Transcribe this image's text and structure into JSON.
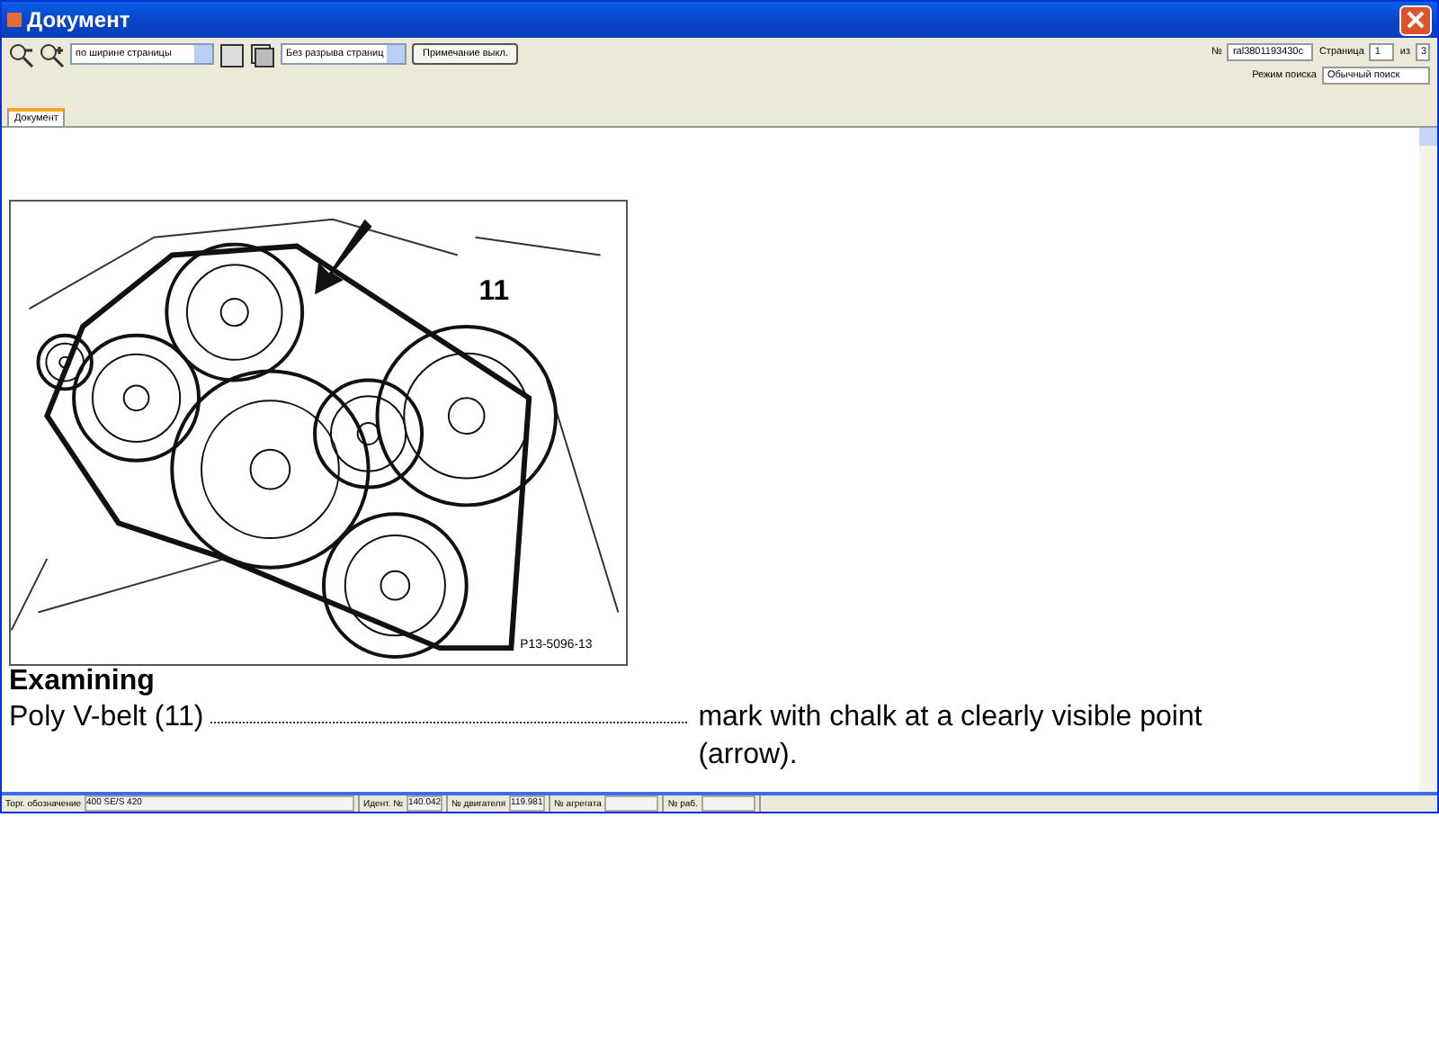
{
  "window": {
    "title": "Документ"
  },
  "toolbar": {
    "zoom_select": "по ширине страницы",
    "page_mode_select": "Без разрыва страниц",
    "notes_button": "Примечание выкл.",
    "number_label": "№",
    "number_value": "ral3801193430c",
    "page_label": "Страница",
    "page_value": "1",
    "of_label": "из",
    "page_total": "3",
    "search_mode_label": "Режим поиска",
    "search_mode_value": "Обычный поиск"
  },
  "tabs": [
    {
      "label": "Документ",
      "selected": true
    }
  ],
  "document": {
    "figure": {
      "callout": "11",
      "code": "P13-5096-13"
    },
    "heading": "Examining",
    "steps": [
      {
        "item": "Poly V-belt (11)",
        "action": "mark with chalk at a clearly visible point (arrow)."
      }
    ]
  },
  "status_bar": [
    {
      "label": "Торг. обозначение",
      "value": "400 SE/S 420"
    },
    {
      "label": "Идент. №",
      "value": "140.042"
    },
    {
      "label": "№ двигателя",
      "value": "119.981"
    },
    {
      "label": "№ агрегата"
    },
    {
      "label": "№ раб."
    }
  ]
}
